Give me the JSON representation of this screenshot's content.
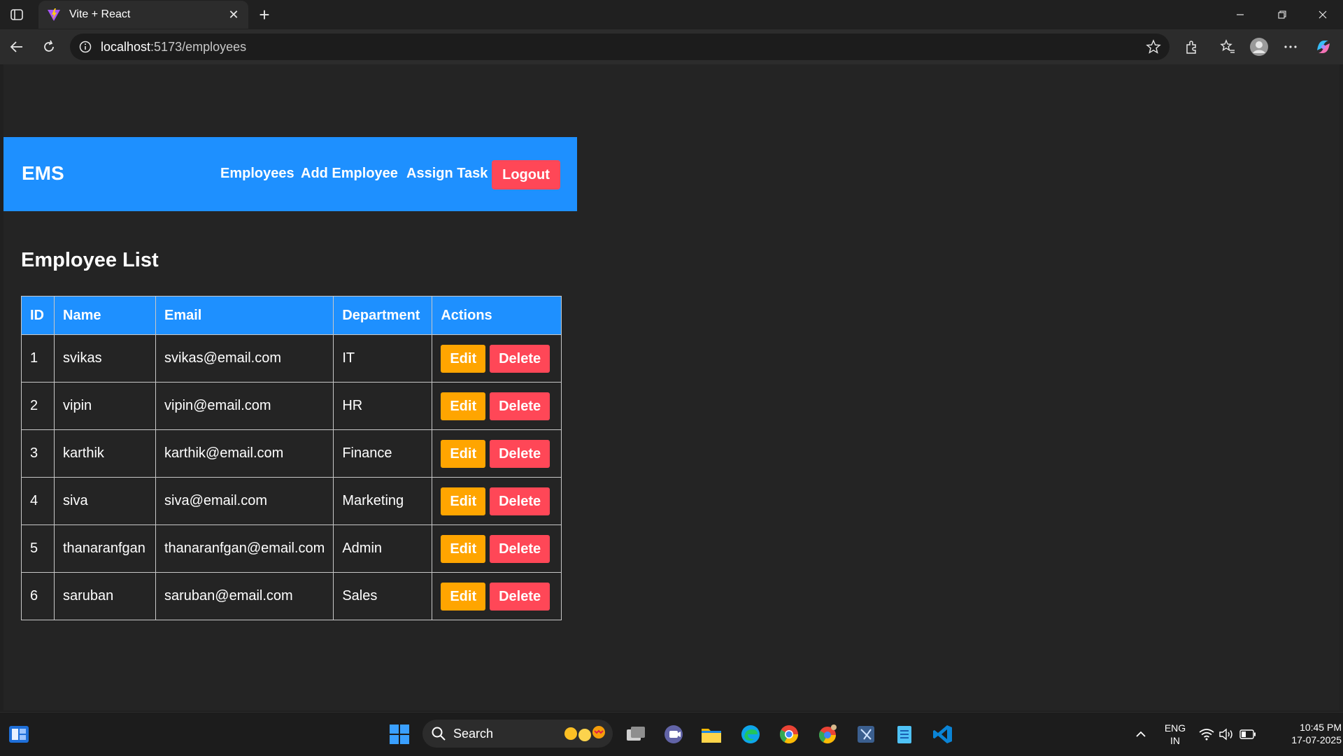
{
  "browser": {
    "tab_title": "Vite + React",
    "tab_close": "✕",
    "new_tab": "+",
    "url_host": "localhost",
    "url_path": ":5173/employees"
  },
  "app": {
    "brand": "EMS",
    "nav": {
      "employees": "Employees",
      "add_employee": "Add Employee",
      "assign_task": "Assign Task",
      "logout": "Logout"
    },
    "title": "Employee List",
    "table": {
      "headers": [
        "ID",
        "Name",
        "Email",
        "Department",
        "Actions"
      ],
      "rows": [
        {
          "id": "1",
          "name": "svikas",
          "email": "svikas@email.com",
          "department": "IT"
        },
        {
          "id": "2",
          "name": "vipin",
          "email": "vipin@email.com",
          "department": "HR"
        },
        {
          "id": "3",
          "name": "karthik",
          "email": "karthik@email.com",
          "department": "Finance"
        },
        {
          "id": "4",
          "name": "siva",
          "email": "siva@email.com",
          "department": "Marketing"
        },
        {
          "id": "5",
          "name": "thanaranfgan",
          "email": "thanaranfgan@email.com",
          "department": "Admin"
        },
        {
          "id": "6",
          "name": "saruban",
          "email": "saruban@email.com",
          "department": "Sales"
        }
      ],
      "edit_label": "Edit",
      "delete_label": "Delete"
    }
  },
  "taskbar": {
    "search_label": "Search",
    "lang_line1": "ENG",
    "lang_line2": "IN",
    "time": "10:45 PM",
    "date": "17-07-2025"
  },
  "colors": {
    "accent": "#1e90ff",
    "danger": "#ff4757",
    "warning": "#ffa500",
    "page_bg": "#242424"
  }
}
